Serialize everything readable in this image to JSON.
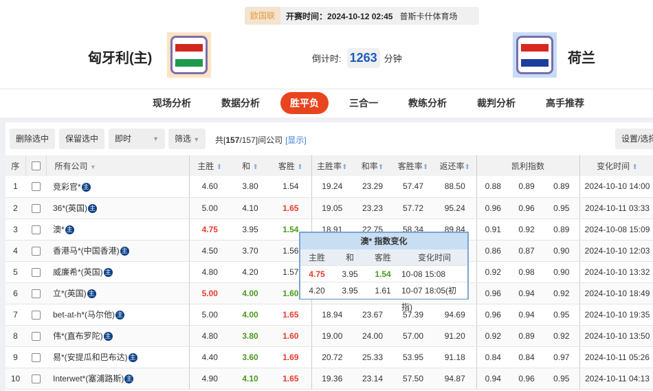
{
  "match": {
    "league": "欧国联",
    "kickoff": "开赛时间：2024-10-12 02:45",
    "venue": "普斯卡什体育场",
    "home": "匈牙利(主)",
    "away": "荷兰",
    "countdown_label": "倒计时:",
    "countdown_value": "1263",
    "countdown_unit": "分钟",
    "home_flag": [
      "#d0281f",
      "#ffffff",
      "#1f9a4c"
    ],
    "away_flag": [
      "#d8281f",
      "#ffffff",
      "#1d3e9a"
    ]
  },
  "nav": [
    {
      "label": "现场分析"
    },
    {
      "label": "数据分析"
    },
    {
      "label": "胜平负",
      "active": true
    },
    {
      "label": "三合一"
    },
    {
      "label": "教练分析"
    },
    {
      "label": "裁判分析"
    },
    {
      "label": "高手推荐"
    }
  ],
  "toolbar": {
    "delete": "删除选中",
    "keep": "保留选中",
    "mode": "即时",
    "filter": "筛选",
    "total_prefix": "共[",
    "total_count": "157",
    "total_suffix": "/157]间公司",
    "show": "[显示]",
    "settings": "设置/选择"
  },
  "columns": {
    "seq": "序",
    "company": "所有公司",
    "home": "主胜",
    "draw": "和",
    "away": "客胜",
    "home_rate": "主胜率",
    "draw_rate": "和率",
    "away_rate": "客胜率",
    "return_rate": "返还率",
    "kelly": "凯利指数",
    "change_time": "变化时间"
  },
  "zhu_badge": "主",
  "colors": {
    "up": "#e8392b",
    "down": "#4a9a1c",
    "accent": "#e8451e"
  },
  "rows": [
    {
      "n": "1",
      "c": "竞彩官*",
      "o": [
        [
          "4.60",
          ""
        ],
        [
          "3.80",
          ""
        ],
        [
          "1.54",
          ""
        ]
      ],
      "r": [
        "19.24",
        "23.29",
        "57.47",
        "88.50"
      ],
      "k": [
        "0.88",
        "0.89",
        "0.89"
      ],
      "t": "2024-10-10 14:00"
    },
    {
      "n": "2",
      "c": "36*(英国)",
      "o": [
        [
          "5.00",
          ""
        ],
        [
          "4.10",
          ""
        ],
        [
          "1.65",
          "red"
        ]
      ],
      "r": [
        "19.05",
        "23.23",
        "57.72",
        "95.24"
      ],
      "k": [
        "0.96",
        "0.96",
        "0.95"
      ],
      "t": "2024-10-11 03:33"
    },
    {
      "n": "3",
      "c": "澳*",
      "o": [
        [
          "4.75",
          "red"
        ],
        [
          "3.95",
          ""
        ],
        [
          "1.54",
          "green"
        ]
      ],
      "r": [
        "18.91",
        "22.75",
        "58.34",
        "89.84"
      ],
      "k": [
        "0.91",
        "0.92",
        "0.89"
      ],
      "t": "2024-10-08 15:09"
    },
    {
      "n": "4",
      "c": "香港马*(中国香港)",
      "o": [
        [
          "4.50",
          ""
        ],
        [
          "3.70",
          ""
        ],
        [
          "1.56",
          ""
        ]
      ],
      "r": [
        "",
        "",
        "",
        ""
      ],
      "k": [
        "0.86",
        "0.87",
        "0.90"
      ],
      "t": "2024-10-10 12:03"
    },
    {
      "n": "5",
      "c": "威廉希*(英国)",
      "o": [
        [
          "4.80",
          ""
        ],
        [
          "4.20",
          ""
        ],
        [
          "1.57",
          ""
        ]
      ],
      "r": [
        "",
        "",
        "",
        ""
      ],
      "k": [
        "0.92",
        "0.98",
        "0.90"
      ],
      "t": "2024-10-10 13:32"
    },
    {
      "n": "6",
      "c": "立*(英国)",
      "o": [
        [
          "5.00",
          "red"
        ],
        [
          "4.00",
          "green"
        ],
        [
          "1.60",
          "green"
        ]
      ],
      "r": [
        "",
        "",
        "",
        ""
      ],
      "k": [
        "0.96",
        "0.94",
        "0.92"
      ],
      "t": "2024-10-10 18:49"
    },
    {
      "n": "7",
      "c": "bet-at-h*(马尔他)",
      "o": [
        [
          "5.00",
          ""
        ],
        [
          "4.00",
          "green"
        ],
        [
          "1.65",
          "red"
        ]
      ],
      "r": [
        "18.94",
        "23.67",
        "57.39",
        "94.69"
      ],
      "k": [
        "0.96",
        "0.94",
        "0.95"
      ],
      "t": "2024-10-10 19:35"
    },
    {
      "n": "8",
      "c": "伟*(直布罗陀)",
      "o": [
        [
          "4.80",
          ""
        ],
        [
          "3.80",
          "green"
        ],
        [
          "1.60",
          "red"
        ]
      ],
      "r": [
        "19.00",
        "24.00",
        "57.00",
        "91.20"
      ],
      "k": [
        "0.92",
        "0.89",
        "0.92"
      ],
      "t": "2024-10-10 13:50"
    },
    {
      "n": "9",
      "c": "易*(安提瓜和巴布达)",
      "o": [
        [
          "4.40",
          ""
        ],
        [
          "3.60",
          "green"
        ],
        [
          "1.69",
          "red"
        ]
      ],
      "r": [
        "20.72",
        "25.33",
        "53.95",
        "91.18"
      ],
      "k": [
        "0.84",
        "0.84",
        "0.97"
      ],
      "t": "2024-10-11 05:26"
    },
    {
      "n": "10",
      "c": "Interwet*(塞浦路斯)",
      "o": [
        [
          "4.90",
          ""
        ],
        [
          "4.10",
          "green"
        ],
        [
          "1.65",
          "red"
        ]
      ],
      "r": [
        "19.36",
        "23.14",
        "57.50",
        "94.87"
      ],
      "k": [
        "0.94",
        "0.96",
        "0.95"
      ],
      "t": "2024-10-11 04:13"
    }
  ],
  "popup": {
    "title": "澳* 指数变化",
    "headers": [
      "主胜",
      "和",
      "客胜",
      "变化时间"
    ],
    "rows": [
      [
        [
          "4.75",
          "red"
        ],
        [
          "3.95",
          ""
        ],
        [
          "1.54",
          "green"
        ],
        [
          "10-08 15:08",
          ""
        ]
      ],
      [
        [
          "4.20",
          ""
        ],
        [
          "3.95",
          ""
        ],
        [
          "1.61",
          ""
        ],
        [
          "10-07 18:05(初指)",
          ""
        ]
      ]
    ]
  }
}
